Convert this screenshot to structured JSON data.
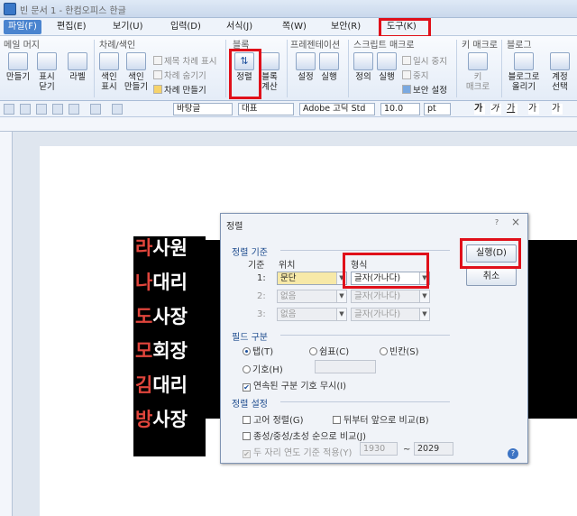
{
  "window": {
    "title": "빈 문서 1 - 한컴오피스 한글"
  },
  "menu": [
    "파일(F)",
    "편집(E)",
    "보기(U)",
    "입력(D)",
    "서식(J)",
    "쪽(W)",
    "보안(R)",
    "도구(K)"
  ],
  "ribbon": {
    "groups": {
      "mail": "메일 머지",
      "index": "차례/색인",
      "block": "블록",
      "presentation": "프레젠테이션",
      "script": "스크립트 매크로",
      "keymacro": "키 매크로",
      "blog": "블로그"
    },
    "buttons": {
      "make": "만들기",
      "show": "표시",
      "close": "닫기",
      "label": "라벨",
      "index_show": "색인",
      "index_show2": "표시",
      "index_make": "색인",
      "index_make2": "만들기",
      "toc_show": "제목 차례 표시",
      "toc_hide": "차례 숨기기",
      "toc_make": "차례 만들기",
      "sort": "정렬",
      "block_calc": "블록",
      "block_calc2": "계산",
      "setting": "설정",
      "run": "실행",
      "define": "정의",
      "script_run": "실행",
      "pause": "일시 중지",
      "stop": "중지",
      "security": "보안 설정",
      "key_macro": "키",
      "key_macro2": "매크로",
      "blog_upload": "블로그로",
      "blog_upload2": "올리기",
      "account": "계정",
      "account2": "선택"
    }
  },
  "toolbar": {
    "style": "바탕글",
    "lang": "대표",
    "font": "Adobe 고딕 Std",
    "size": "10.0",
    "unit": "pt"
  },
  "document": {
    "names": [
      {
        "first": "라",
        "rest": "사원"
      },
      {
        "first": "나",
        "rest": "대리"
      },
      {
        "first": "도",
        "rest": "사장"
      },
      {
        "first": "모",
        "rest": "회장"
      },
      {
        "first": "김",
        "rest": "대리"
      },
      {
        "first": "방",
        "rest": "사장"
      }
    ]
  },
  "dialog": {
    "title": "정렬",
    "sort_criteria": "정렬 기준",
    "col_key": "기준",
    "col_pos": "위치",
    "col_format": "형식",
    "rows": [
      {
        "key": "1:",
        "pos": "문단",
        "format": "글자(가나다)"
      },
      {
        "key": "2:",
        "pos": "없음",
        "format": "글자(가나다)"
      },
      {
        "key": "3:",
        "pos": "없음",
        "format": "글자(가나다)"
      }
    ],
    "field_sep": "필드 구분",
    "tab": "탭(T)",
    "comma": "쉼표(C)",
    "space": "빈칸(S)",
    "symbol": "기호(H)",
    "ignore_consecutive": "연속된 구분 기호 무시(I)",
    "sort_settings": "정렬 설정",
    "stable": "고어 정렬(G)",
    "reverse": "뒤부터 앞으로 비교(B)",
    "jamo": "종성/중성/초성 순으로 비교(J)",
    "two_digit": "두 자리 연도 기준 적용(Y)",
    "year_from": "1930",
    "year_to": "2029",
    "run": "실행(D)",
    "cancel": "취소",
    "help": "?",
    "close": "×"
  }
}
